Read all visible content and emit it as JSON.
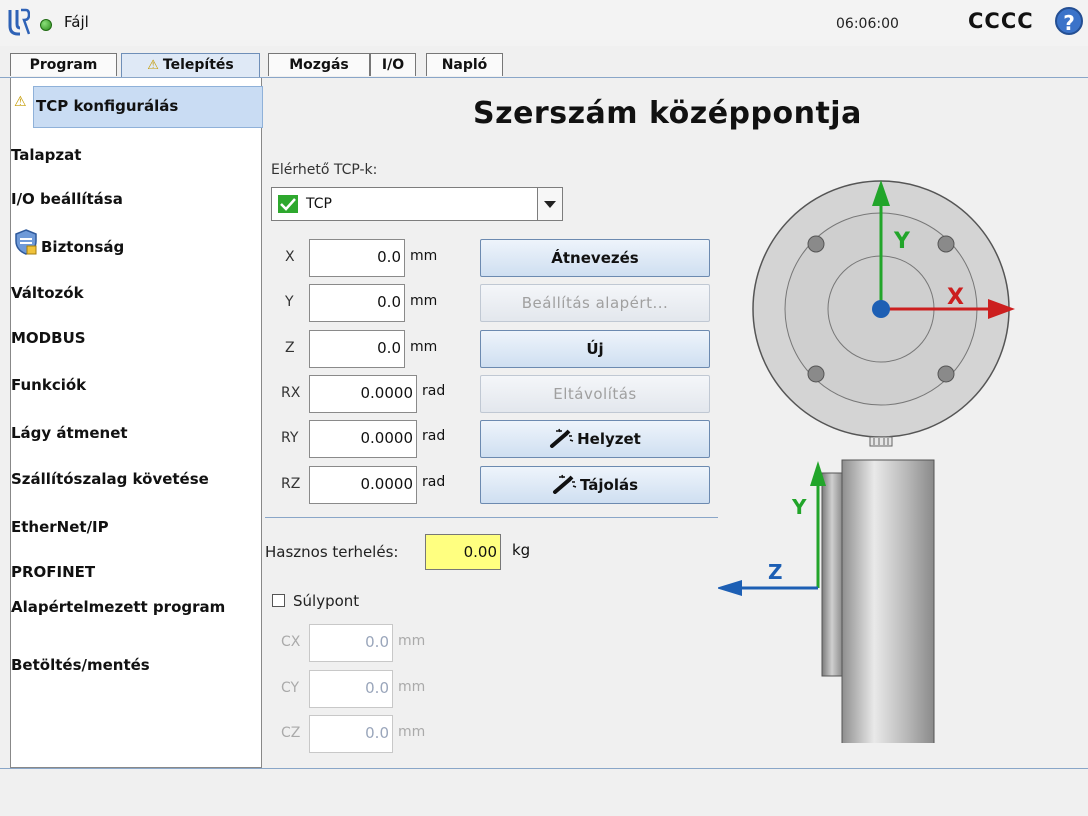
{
  "topbar": {
    "file_label": "Fájl",
    "time": "06:06:00",
    "robot_name": "CCCC",
    "help_glyph": "?"
  },
  "tabs": [
    {
      "label": "Program",
      "active": false
    },
    {
      "label": "Telepítés",
      "active": true,
      "warning": true
    },
    {
      "label": "Mozgás",
      "active": false
    },
    {
      "label": "I/O",
      "active": false
    },
    {
      "label": "Napló",
      "active": false
    }
  ],
  "sidebar": {
    "items": [
      {
        "label": "TCP konfigurálás",
        "selected": true,
        "icon": "warning-icon"
      },
      {
        "label": "Talapzat"
      },
      {
        "label": "I/O beállítása"
      },
      {
        "label": "Biztonság",
        "icon": "safety-shield-icon"
      },
      {
        "label": "Változók"
      },
      {
        "label": "MODBUS"
      },
      {
        "label": "Funkciók"
      },
      {
        "label": "Lágy átmenet"
      },
      {
        "label": "Szállítószalag követése"
      },
      {
        "label": "EtherNet/IP"
      },
      {
        "label": "PROFINET"
      },
      {
        "label": "Alapértelmezett program"
      },
      {
        "label": "Betöltés/mentés"
      }
    ]
  },
  "main": {
    "title": "Szerszám középpontja",
    "tcp_label": "Elérhető TCP-k:",
    "tcp_selected": "TCP",
    "fields": [
      {
        "axis": "X",
        "value": "0.0",
        "unit": "mm"
      },
      {
        "axis": "Y",
        "value": "0.0",
        "unit": "mm"
      },
      {
        "axis": "Z",
        "value": "0.0",
        "unit": "mm"
      },
      {
        "axis": "RX",
        "value": "0.0000",
        "unit": "rad"
      },
      {
        "axis": "RY",
        "value": "0.0000",
        "unit": "rad"
      },
      {
        "axis": "RZ",
        "value": "0.0000",
        "unit": "rad"
      }
    ],
    "buttons": [
      {
        "label": "Átnevezés",
        "enabled": true
      },
      {
        "label": "Beállítás alapért...",
        "enabled": false
      },
      {
        "label": "Új",
        "enabled": true
      },
      {
        "label": "Eltávolítás",
        "enabled": false
      },
      {
        "label": "Helyzet",
        "enabled": true,
        "icon": "magic-wand-icon"
      },
      {
        "label": "Tájolás",
        "enabled": true,
        "icon": "magic-wand-icon"
      }
    ],
    "payload_label": "Hasznos terhelés:",
    "payload_value": "0.00",
    "payload_unit": "kg",
    "cog_label": "Súlypont",
    "cog_checked": false,
    "cog_fields": [
      {
        "axis": "CX",
        "value": "0.0",
        "unit": "mm"
      },
      {
        "axis": "CY",
        "value": "0.0",
        "unit": "mm"
      },
      {
        "axis": "CZ",
        "value": "0.0",
        "unit": "mm"
      }
    ],
    "diagram_axes": {
      "x": "X",
      "y": "Y",
      "z": "Z"
    }
  },
  "colors": {
    "x_axis": "#cc1f1f",
    "y_axis": "#22a52a",
    "z_axis": "#1d5fb4",
    "payload_field": "#ffff80",
    "tab_active": "#dfe9f6",
    "sidebar_selected": "#c9dcf3"
  }
}
